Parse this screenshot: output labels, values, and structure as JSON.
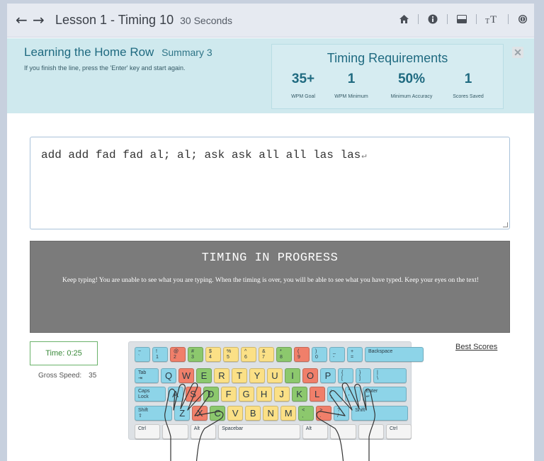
{
  "header": {
    "back_icon": "arrow-left-icon",
    "forward_icon": "arrow-right-icon",
    "title": "Lesson 1 - Timing 10",
    "duration": "30 Seconds",
    "icons": [
      "home-icon",
      "info-icon",
      "keyboard-toggle-icon",
      "text-size-icon",
      "settings-icon"
    ]
  },
  "summary": {
    "title": "Learning the Home Row",
    "subtitle": "Summary 3",
    "instruction": "If you finish the line, press the 'Enter' key and start again.",
    "close": "✕"
  },
  "requirements": {
    "title": "Timing Requirements",
    "items": [
      {
        "value": "35+",
        "label": "WPM Goal"
      },
      {
        "value": "1",
        "label": "WPM Minimum"
      },
      {
        "value": "50%",
        "label": "Minimum Accuracy"
      },
      {
        "value": "1",
        "label": "Scores Saved"
      }
    ]
  },
  "typing": {
    "text": "add add fad fad al; al; ask ask all all las las",
    "return_glyph": "↵"
  },
  "progress": {
    "title": "TIMING IN PROGRESS",
    "message": "Keep typing! You are unable to see what you are typing. When the timing is over, you will be able to see what you have typed. Keep your eyes on the text!"
  },
  "stats": {
    "timer": "Time: 0:25",
    "gross_label": "Gross Speed:",
    "gross_value": "35",
    "best_scores": "Best Scores"
  },
  "colors": {
    "blue": "#8dd4e8",
    "red": "#f07f6a",
    "green": "#8cc86d",
    "yellow": "#fbe086",
    "gray": "#f4f4f4"
  },
  "keyboard": {
    "rows": [
      [
        {
          "label": "~\n`",
          "color": "blue"
        },
        {
          "label": "!\n1",
          "color": "blue"
        },
        {
          "label": "@\n2",
          "color": "red"
        },
        {
          "label": "#\n3",
          "color": "green"
        },
        {
          "label": "$\n4",
          "color": "yellow"
        },
        {
          "label": "%\n5",
          "color": "yellow"
        },
        {
          "label": "^\n6",
          "color": "yellow"
        },
        {
          "label": "&\n7",
          "color": "yellow"
        },
        {
          "label": "*\n8",
          "color": "green"
        },
        {
          "label": "(\n9",
          "color": "red"
        },
        {
          "label": ")\n0",
          "color": "blue"
        },
        {
          "label": "_\n-",
          "color": "blue"
        },
        {
          "label": "+\n=",
          "color": "blue"
        },
        {
          "label": "Backspace",
          "color": "blue"
        }
      ],
      [
        {
          "label": "Tab\n⇥",
          "color": "blue"
        },
        {
          "label": "Q",
          "color": "blue"
        },
        {
          "label": "W",
          "color": "red"
        },
        {
          "label": "E",
          "color": "green"
        },
        {
          "label": "R",
          "color": "yellow"
        },
        {
          "label": "T",
          "color": "yellow"
        },
        {
          "label": "Y",
          "color": "yellow"
        },
        {
          "label": "U",
          "color": "yellow"
        },
        {
          "label": "I",
          "color": "green"
        },
        {
          "label": "O",
          "color": "red"
        },
        {
          "label": "P",
          "color": "blue"
        },
        {
          "label": "{\n[",
          "color": "blue"
        },
        {
          "label": "}\n]",
          "color": "blue"
        },
        {
          "label": "|\n\\",
          "color": "blue"
        }
      ],
      [
        {
          "label": "Caps\nLock",
          "color": "blue"
        },
        {
          "label": "A",
          "color": "blue"
        },
        {
          "label": "S",
          "color": "red"
        },
        {
          "label": "D",
          "color": "green"
        },
        {
          "label": "F",
          "color": "yellow"
        },
        {
          "label": "G",
          "color": "yellow"
        },
        {
          "label": "H",
          "color": "yellow"
        },
        {
          "label": "J",
          "color": "yellow"
        },
        {
          "label": "K",
          "color": "green"
        },
        {
          "label": "L",
          "color": "red"
        },
        {
          "label": ":\n;",
          "color": "blue"
        },
        {
          "label": "\"\n'",
          "color": "blue"
        },
        {
          "label": "Enter\n↵",
          "color": "blue"
        }
      ],
      [
        {
          "label": "Shift\n⇧",
          "color": "blue"
        },
        {
          "label": "Z",
          "color": "blue"
        },
        {
          "label": "X",
          "color": "red"
        },
        {
          "label": "C",
          "color": "green"
        },
        {
          "label": "V",
          "color": "yellow"
        },
        {
          "label": "B",
          "color": "yellow"
        },
        {
          "label": "N",
          "color": "yellow"
        },
        {
          "label": "M",
          "color": "yellow"
        },
        {
          "label": "<\n,",
          "color": "green"
        },
        {
          "label": ">\n.",
          "color": "red"
        },
        {
          "label": "?\n/",
          "color": "blue"
        },
        {
          "label": "Shift",
          "color": "blue"
        }
      ],
      [
        {
          "label": "Ctrl",
          "color": "gray"
        },
        {
          "label": "",
          "color": "gray"
        },
        {
          "label": "Alt",
          "color": "gray"
        },
        {
          "label": "Spacebar",
          "color": "gray"
        },
        {
          "label": "Alt",
          "color": "gray"
        },
        {
          "label": "",
          "color": "gray"
        },
        {
          "label": "",
          "color": "gray"
        },
        {
          "label": "Ctrl",
          "color": "gray"
        }
      ]
    ]
  }
}
